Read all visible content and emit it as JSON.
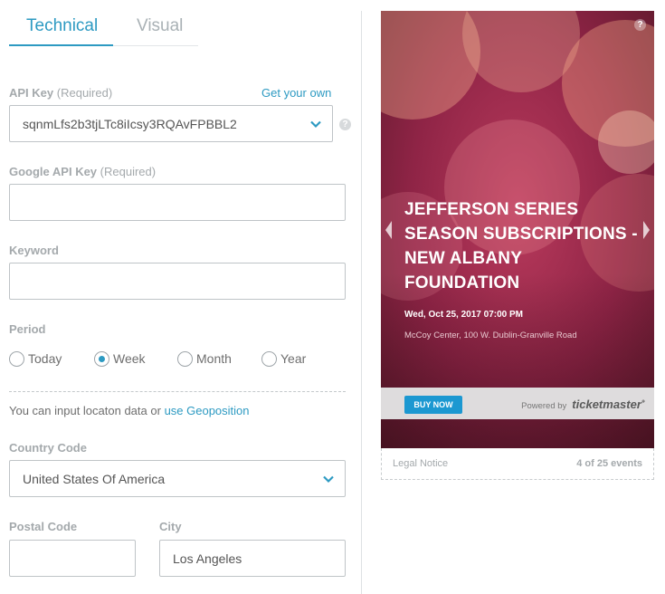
{
  "tabs": [
    {
      "label": "Technical",
      "active": true
    },
    {
      "label": "Visual",
      "active": false
    }
  ],
  "api_key": {
    "label": "API Key",
    "required": "(Required)",
    "link": "Get your own",
    "value": "sqnmLfs2b3tjLTc8iIcsy3RQAvFPBBL2"
  },
  "google_api_key": {
    "label": "Google API Key",
    "required": "(Required)",
    "value": ""
  },
  "keyword": {
    "label": "Keyword",
    "value": ""
  },
  "period": {
    "label": "Period",
    "options": [
      "Today",
      "Week",
      "Month",
      "Year"
    ],
    "selected": "Week"
  },
  "geo": {
    "text": "You can input locaton data or",
    "link": "use Geoposition"
  },
  "country": {
    "label": "Country Code",
    "value": "United States Of America"
  },
  "postal": {
    "label": "Postal Code",
    "value": ""
  },
  "city": {
    "label": "City",
    "value": "Los Angeles"
  },
  "widget": {
    "help": "?",
    "title": "JEFFERSON SERIES SEASON SUBSCRIPTIONS - NEW ALBANY FOUNDATION",
    "date": "Wed, Oct 25, 2017 07:00 PM",
    "venue": "McCoy Center, 100 W. Dublin-Granville Road",
    "buy_now": "BUY NOW",
    "powered_by": "Powered by",
    "brand": "ticketmaster",
    "legal": "Legal Notice",
    "events_count": "4 of 25 events"
  },
  "icons": {
    "help": "question-circle-icon",
    "dropdown": "chevron-down-icon"
  },
  "colors": {
    "accent": "#2d9ac2",
    "widget_bg": "#8f2446",
    "buy_button": "#1c98d1"
  }
}
